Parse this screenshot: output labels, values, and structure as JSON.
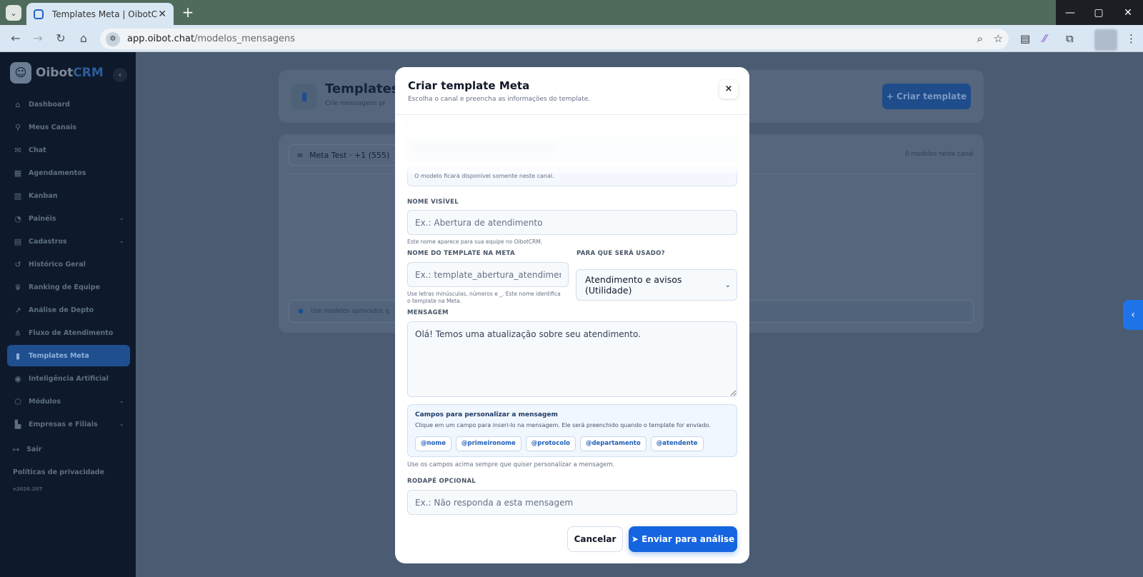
{
  "browser": {
    "tab_title": "Templates Meta | OibotCRM",
    "url_host": "app.oibot.chat",
    "url_path": "/modelos_mensagens"
  },
  "sidebar": {
    "brand_a": "Oibot",
    "brand_b": "CRM",
    "items": [
      {
        "label": "Dashboard",
        "icon": "home-icon",
        "glyph": "⌂"
      },
      {
        "label": "Meus Canais",
        "icon": "channels-icon",
        "glyph": "⚲"
      },
      {
        "label": "Chat",
        "icon": "chat-icon",
        "glyph": "✉"
      },
      {
        "label": "Agendamentos",
        "icon": "calendar-icon",
        "glyph": "▦"
      },
      {
        "label": "Kanban",
        "icon": "kanban-icon",
        "glyph": "▥"
      },
      {
        "label": "Painéis",
        "icon": "chart-pie-icon",
        "glyph": "◔",
        "chevron": "⌄"
      },
      {
        "label": "Cadastros",
        "icon": "id-card-icon",
        "glyph": "▤",
        "chevron": "⌄"
      },
      {
        "label": "Histórico Geral",
        "icon": "history-icon",
        "glyph": "↺"
      },
      {
        "label": "Ranking de Equipe",
        "icon": "trophy-icon",
        "glyph": "♛"
      },
      {
        "label": "Análise de Depto",
        "icon": "line-chart-icon",
        "glyph": "↗"
      },
      {
        "label": "Fluxo de Atendimento",
        "icon": "flow-icon",
        "glyph": "⋔"
      },
      {
        "label": "Templates Meta",
        "icon": "template-icon",
        "glyph": "▮",
        "active": true
      },
      {
        "label": "Inteligência Artificial",
        "icon": "brain-icon",
        "glyph": "◉"
      },
      {
        "label": "Módulos",
        "icon": "cubes-icon",
        "glyph": "⬡",
        "chevron": "⌄"
      },
      {
        "label": "Empresas e Filiais",
        "icon": "building-icon",
        "glyph": "▙",
        "chevron": "⌄"
      }
    ],
    "logout": "Sair",
    "privacy": "Políticas de privacidade",
    "version": "v2026.207"
  },
  "page": {
    "title": "Templates",
    "subtitle": "Crie mensagens pr",
    "create_button": "+ Criar template",
    "channel_label": "Meta Test · +1 (555)",
    "models_count": "0 modelos neste canal",
    "info_text": "Use modelos aprovados q"
  },
  "modal": {
    "title": "Criar template Meta",
    "subtitle": "Escolha o canal e preencha as informações do template.",
    "close": "×",
    "channel_hint": "O modelo ficará disponível somente neste canal.",
    "visible_name": {
      "label": "NOME VISÍVEL",
      "placeholder": "Ex.: Abertura de atendimento",
      "help": "Este nome aparece para sua equipe no OibotCRM."
    },
    "meta_name": {
      "label": "NOME DO TEMPLATE NA META",
      "placeholder": "Ex.: template_abertura_atendimento",
      "help": "Use letras minúsculas, números e _. Este nome identifica o template na Meta."
    },
    "usage": {
      "label": "PARA QUE SERÁ USADO?",
      "value": "Atendimento e avisos (Utilidade)"
    },
    "message": {
      "label": "MENSAGEM",
      "value": "Olá! Temos uma atualização sobre seu atendimento."
    },
    "fields": {
      "title": "Campos para personalizar a mensagem",
      "subtitle": "Clique em um campo para inseri-lo na mensagem. Ele será preenchido quando o template for enviado.",
      "chips": [
        "@nome",
        "@primeironome",
        "@protocolo",
        "@departamento",
        "@atendente"
      ],
      "note": "Use os campos acima sempre que quiser personalizar a mensagem."
    },
    "footer": {
      "label": "RODAPÉ OPCIONAL",
      "placeholder": "Ex.: Não responda a esta mensagem"
    },
    "cancel": "Cancelar",
    "submit": "Enviar para análise"
  }
}
